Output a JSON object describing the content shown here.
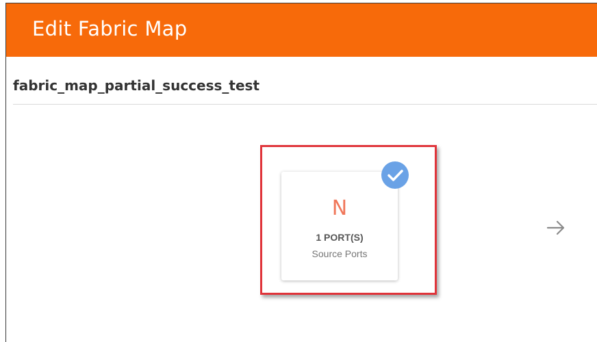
{
  "header": {
    "title": "Edit Fabric Map"
  },
  "fabric_map": {
    "name": "fabric_map_partial_success_test"
  },
  "port_card": {
    "icon": "N",
    "count_label": "1 PORT(S)",
    "description": "Source Ports",
    "selected": true
  },
  "icons": {
    "check": "check-icon",
    "next": "arrow-right-icon"
  },
  "colors": {
    "header_bg": "#f76a0a",
    "highlight_border": "#e0343a",
    "check_badge": "#6aa2e6",
    "card_icon": "#f0775a"
  }
}
